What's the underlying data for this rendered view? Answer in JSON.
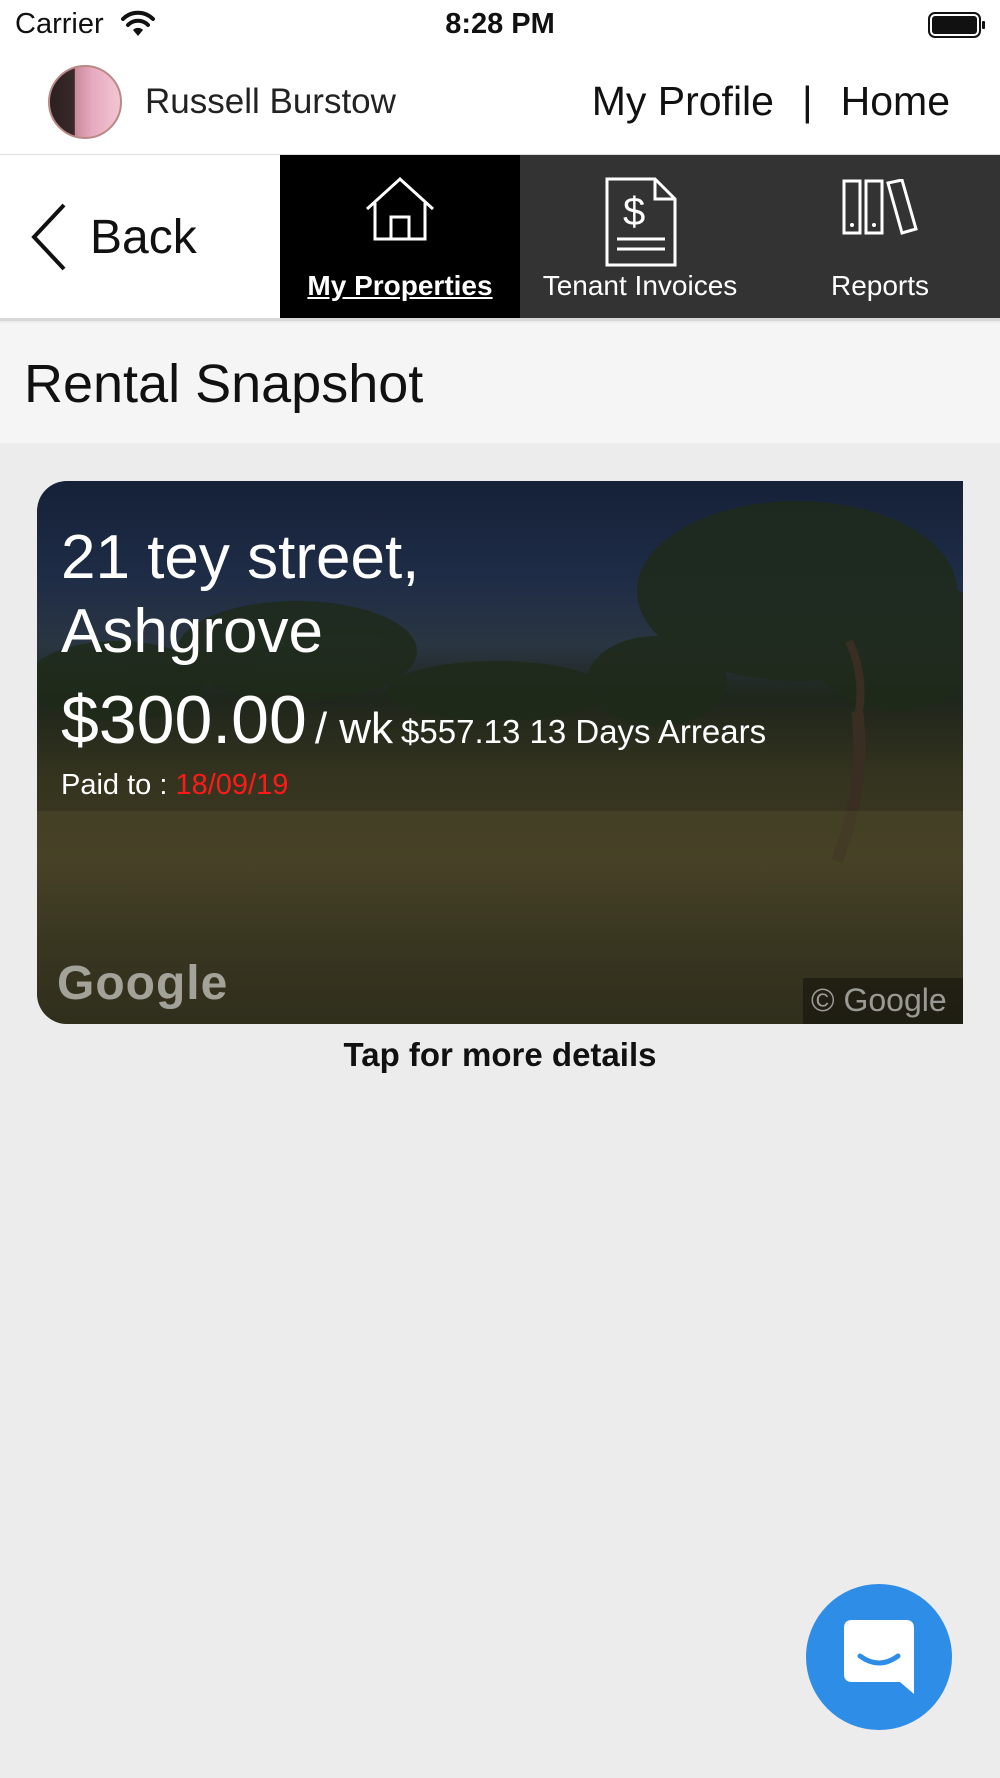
{
  "status_bar": {
    "carrier": "Carrier",
    "time": "8:28 PM"
  },
  "header": {
    "user_name": "Russell Burstow",
    "profile_link": "My Profile",
    "separator": "|",
    "home_link": "Home"
  },
  "nav": {
    "back_label": "Back",
    "tabs": [
      {
        "label": "My Properties",
        "icon": "house-icon",
        "active": true
      },
      {
        "label": "Tenant Invoices",
        "icon": "invoice-icon",
        "active": false
      },
      {
        "label": "Reports",
        "icon": "books-icon",
        "active": false
      }
    ]
  },
  "page": {
    "title": "Rental Snapshot"
  },
  "property": {
    "address": "21 tey street, Ashgrove",
    "rent": "$300.00",
    "rent_period": "/ wk",
    "arrears": "$557.13 13 Days Arrears",
    "paid_label": "Paid to :",
    "paid_date": "18/09/19",
    "watermark": "Google",
    "copyright": "© Google"
  },
  "hint": "Tap for more details",
  "colors": {
    "accent": "#2e8de6",
    "overdue": "#ff1a1a",
    "tab_active": "#000000",
    "tab_bg": "#333333"
  }
}
